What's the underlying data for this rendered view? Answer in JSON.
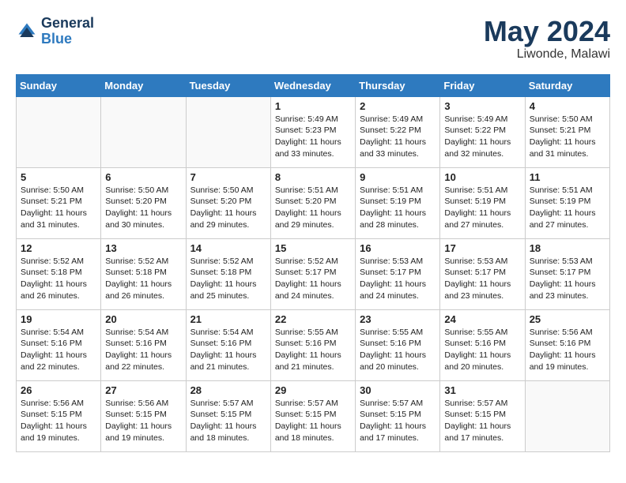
{
  "logo": {
    "line1": "General",
    "line2": "Blue"
  },
  "title": "May 2024",
  "location": "Liwonde, Malawi",
  "weekdays": [
    "Sunday",
    "Monday",
    "Tuesday",
    "Wednesday",
    "Thursday",
    "Friday",
    "Saturday"
  ],
  "weeks": [
    [
      {
        "day": "",
        "info": ""
      },
      {
        "day": "",
        "info": ""
      },
      {
        "day": "",
        "info": ""
      },
      {
        "day": "1",
        "info": "Sunrise: 5:49 AM\nSunset: 5:23 PM\nDaylight: 11 hours\nand 33 minutes."
      },
      {
        "day": "2",
        "info": "Sunrise: 5:49 AM\nSunset: 5:22 PM\nDaylight: 11 hours\nand 33 minutes."
      },
      {
        "day": "3",
        "info": "Sunrise: 5:49 AM\nSunset: 5:22 PM\nDaylight: 11 hours\nand 32 minutes."
      },
      {
        "day": "4",
        "info": "Sunrise: 5:50 AM\nSunset: 5:21 PM\nDaylight: 11 hours\nand 31 minutes."
      }
    ],
    [
      {
        "day": "5",
        "info": "Sunrise: 5:50 AM\nSunset: 5:21 PM\nDaylight: 11 hours\nand 31 minutes."
      },
      {
        "day": "6",
        "info": "Sunrise: 5:50 AM\nSunset: 5:20 PM\nDaylight: 11 hours\nand 30 minutes."
      },
      {
        "day": "7",
        "info": "Sunrise: 5:50 AM\nSunset: 5:20 PM\nDaylight: 11 hours\nand 29 minutes."
      },
      {
        "day": "8",
        "info": "Sunrise: 5:51 AM\nSunset: 5:20 PM\nDaylight: 11 hours\nand 29 minutes."
      },
      {
        "day": "9",
        "info": "Sunrise: 5:51 AM\nSunset: 5:19 PM\nDaylight: 11 hours\nand 28 minutes."
      },
      {
        "day": "10",
        "info": "Sunrise: 5:51 AM\nSunset: 5:19 PM\nDaylight: 11 hours\nand 27 minutes."
      },
      {
        "day": "11",
        "info": "Sunrise: 5:51 AM\nSunset: 5:19 PM\nDaylight: 11 hours\nand 27 minutes."
      }
    ],
    [
      {
        "day": "12",
        "info": "Sunrise: 5:52 AM\nSunset: 5:18 PM\nDaylight: 11 hours\nand 26 minutes."
      },
      {
        "day": "13",
        "info": "Sunrise: 5:52 AM\nSunset: 5:18 PM\nDaylight: 11 hours\nand 26 minutes."
      },
      {
        "day": "14",
        "info": "Sunrise: 5:52 AM\nSunset: 5:18 PM\nDaylight: 11 hours\nand 25 minutes."
      },
      {
        "day": "15",
        "info": "Sunrise: 5:52 AM\nSunset: 5:17 PM\nDaylight: 11 hours\nand 24 minutes."
      },
      {
        "day": "16",
        "info": "Sunrise: 5:53 AM\nSunset: 5:17 PM\nDaylight: 11 hours\nand 24 minutes."
      },
      {
        "day": "17",
        "info": "Sunrise: 5:53 AM\nSunset: 5:17 PM\nDaylight: 11 hours\nand 23 minutes."
      },
      {
        "day": "18",
        "info": "Sunrise: 5:53 AM\nSunset: 5:17 PM\nDaylight: 11 hours\nand 23 minutes."
      }
    ],
    [
      {
        "day": "19",
        "info": "Sunrise: 5:54 AM\nSunset: 5:16 PM\nDaylight: 11 hours\nand 22 minutes."
      },
      {
        "day": "20",
        "info": "Sunrise: 5:54 AM\nSunset: 5:16 PM\nDaylight: 11 hours\nand 22 minutes."
      },
      {
        "day": "21",
        "info": "Sunrise: 5:54 AM\nSunset: 5:16 PM\nDaylight: 11 hours\nand 21 minutes."
      },
      {
        "day": "22",
        "info": "Sunrise: 5:55 AM\nSunset: 5:16 PM\nDaylight: 11 hours\nand 21 minutes."
      },
      {
        "day": "23",
        "info": "Sunrise: 5:55 AM\nSunset: 5:16 PM\nDaylight: 11 hours\nand 20 minutes."
      },
      {
        "day": "24",
        "info": "Sunrise: 5:55 AM\nSunset: 5:16 PM\nDaylight: 11 hours\nand 20 minutes."
      },
      {
        "day": "25",
        "info": "Sunrise: 5:56 AM\nSunset: 5:16 PM\nDaylight: 11 hours\nand 19 minutes."
      }
    ],
    [
      {
        "day": "26",
        "info": "Sunrise: 5:56 AM\nSunset: 5:15 PM\nDaylight: 11 hours\nand 19 minutes."
      },
      {
        "day": "27",
        "info": "Sunrise: 5:56 AM\nSunset: 5:15 PM\nDaylight: 11 hours\nand 19 minutes."
      },
      {
        "day": "28",
        "info": "Sunrise: 5:57 AM\nSunset: 5:15 PM\nDaylight: 11 hours\nand 18 minutes."
      },
      {
        "day": "29",
        "info": "Sunrise: 5:57 AM\nSunset: 5:15 PM\nDaylight: 11 hours\nand 18 minutes."
      },
      {
        "day": "30",
        "info": "Sunrise: 5:57 AM\nSunset: 5:15 PM\nDaylight: 11 hours\nand 17 minutes."
      },
      {
        "day": "31",
        "info": "Sunrise: 5:57 AM\nSunset: 5:15 PM\nDaylight: 11 hours\nand 17 minutes."
      },
      {
        "day": "",
        "info": ""
      }
    ]
  ]
}
